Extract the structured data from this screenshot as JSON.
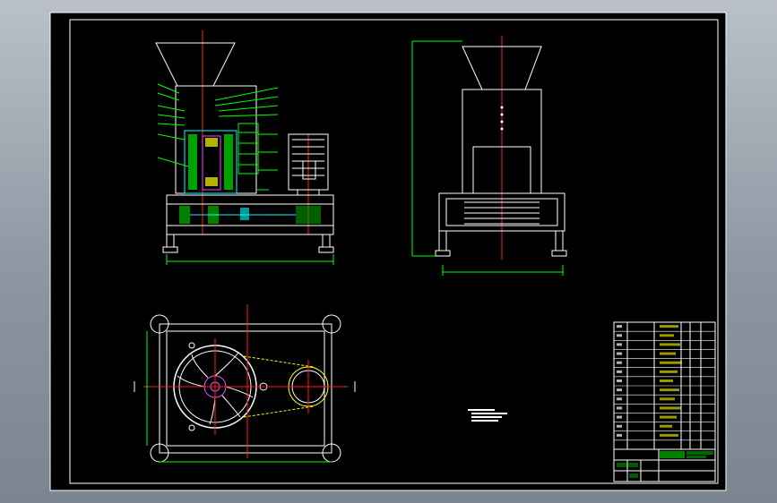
{
  "drawing": {
    "background_color": "#000000",
    "frame_color": "#ffffff",
    "centerline_color": "#ff2020",
    "dimension_color": "#00ff00",
    "section_color": "#00ffff",
    "outline_color": "#ffffff",
    "leader_color": "#00ff00"
  },
  "title_block": {
    "accent_color": "#00ff00",
    "text_color": "#ffff00",
    "parts_rows": 14
  },
  "icons": {
    "motor": "motor-icon",
    "hopper": "hopper-icon",
    "impeller": "impeller-icon",
    "pulley": "pulley-icon"
  }
}
